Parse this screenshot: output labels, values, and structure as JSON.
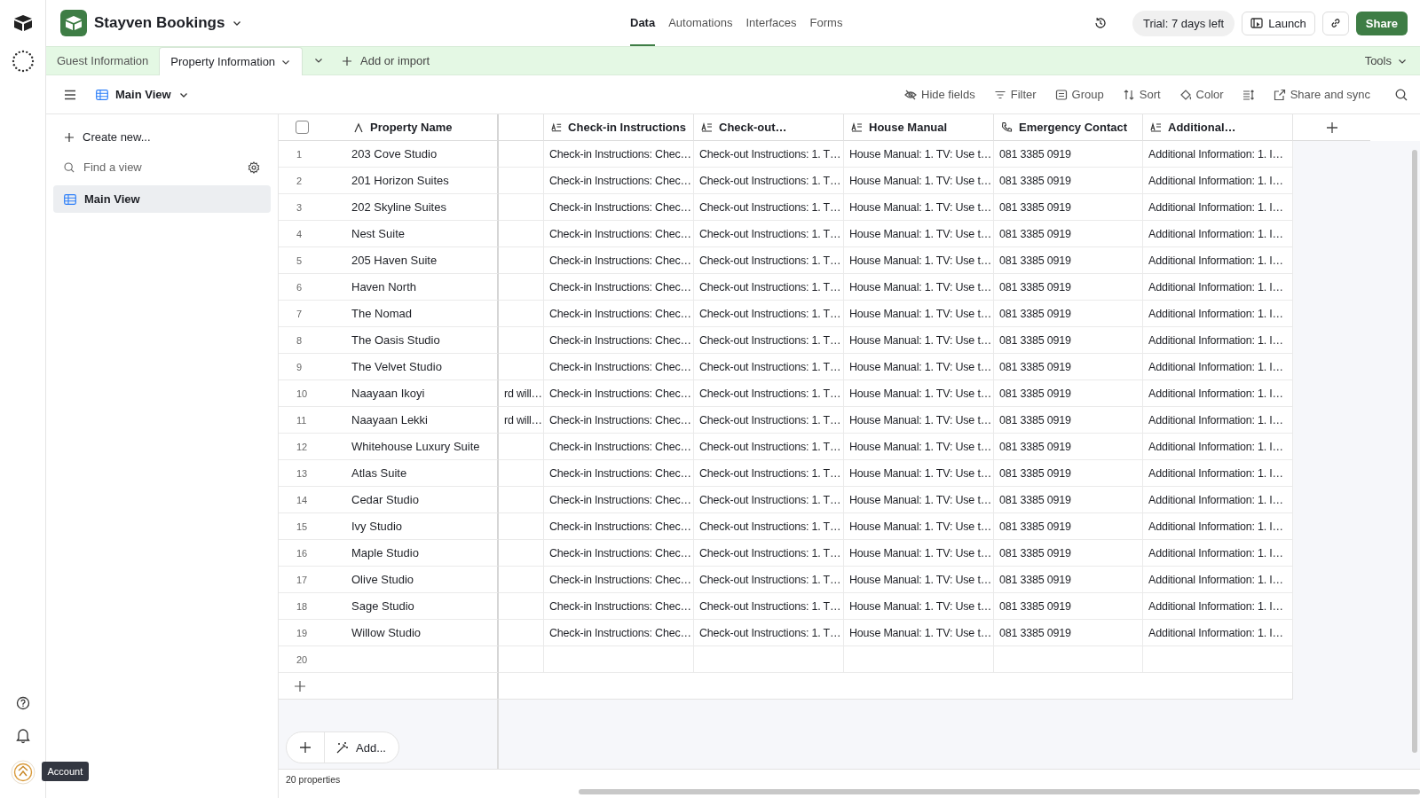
{
  "app": {
    "name": "Stayven Bookings"
  },
  "nav": [
    {
      "label": "Data",
      "selected": true
    },
    {
      "label": "Automations",
      "selected": false
    },
    {
      "label": "Interfaces",
      "selected": false
    },
    {
      "label": "Forms",
      "selected": false
    }
  ],
  "trial_badge": "Trial: 7 days left",
  "header_buttons": {
    "launch": "Launch",
    "share": "Share"
  },
  "table_tabs": [
    {
      "label": "Guest Information",
      "selected": false
    },
    {
      "label": "Property Information",
      "selected": true
    }
  ],
  "add_import": "Add or import",
  "tools": "Tools",
  "view_name": "Main View",
  "view_tools": [
    {
      "label": "Hide fields",
      "kind": "hide"
    },
    {
      "label": "Filter",
      "kind": "filter"
    },
    {
      "label": "Group",
      "kind": "group"
    },
    {
      "label": "Sort",
      "kind": "sort"
    },
    {
      "label": "Color",
      "kind": "color"
    },
    {
      "kind": "row_height"
    },
    {
      "label": "Share and sync",
      "kind": "share"
    }
  ],
  "sidebar": {
    "create": "Create new...",
    "search_placeholder": "Find a view",
    "items": [
      {
        "label": "Main View",
        "selected": true
      }
    ]
  },
  "select_all": {
    "checked": false
  },
  "columns": [
    {
      "label": "Property Name",
      "kind": "primary"
    },
    {
      "kind": "partial"
    },
    {
      "label": "Check-in Instructions",
      "kind": "long_text"
    },
    {
      "label": "Check-out…",
      "kind": "long_text"
    },
    {
      "label": "House Manual",
      "kind": "long_text"
    },
    {
      "label": "Emergency Contact",
      "kind": "phone"
    },
    {
      "label": "Additional…",
      "kind": "long_text"
    }
  ],
  "rows": [
    {
      "number": "1",
      "cells": [
        "203 Cove Studio",
        "",
        "Check-in Instructions: Chec…",
        "Check-out Instructions: 1. T…",
        "House Manual: 1. TV: Use t…",
        "081 3385 0919",
        "Additional Information: 1. I…"
      ]
    },
    {
      "number": "2",
      "cells": [
        "201 Horizon Suites",
        "",
        "Check-in Instructions: Chec…",
        "Check-out Instructions: 1. T…",
        "House Manual: 1. TV: Use t…",
        "081 3385 0919",
        "Additional Information: 1. I…"
      ]
    },
    {
      "number": "3",
      "cells": [
        "202 Skyline Suites",
        "",
        "Check-in Instructions: Chec…",
        "Check-out Instructions: 1. T…",
        "House Manual: 1. TV: Use t…",
        "081 3385 0919",
        "Additional Information: 1. I…"
      ]
    },
    {
      "number": "4",
      "cells": [
        "Nest Suite",
        "",
        "Check-in Instructions: Chec…",
        "Check-out Instructions: 1. T…",
        "House Manual: 1. TV: Use t…",
        "081 3385 0919",
        "Additional Information: 1. I…"
      ]
    },
    {
      "number": "5",
      "cells": [
        "205 Haven Suite",
        "",
        "Check-in Instructions: Chec…",
        "Check-out Instructions: 1. T…",
        "House Manual: 1. TV: Use t…",
        "081 3385 0919",
        "Additional Information: 1. I…"
      ]
    },
    {
      "number": "6",
      "cells": [
        "Haven North",
        "",
        "Check-in Instructions: Chec…",
        "Check-out Instructions: 1. T…",
        "House Manual: 1. TV: Use t…",
        "081 3385 0919",
        "Additional Information: 1. I…"
      ]
    },
    {
      "number": "7",
      "cells": [
        "The Nomad",
        "",
        "Check-in Instructions: Chec…",
        "Check-out Instructions: 1. T…",
        "House Manual: 1. TV: Use t…",
        "081 3385 0919",
        "Additional Information: 1. I…"
      ]
    },
    {
      "number": "8",
      "cells": [
        "The Oasis Studio",
        "",
        "Check-in Instructions: Chec…",
        "Check-out Instructions: 1. T…",
        "House Manual: 1. TV: Use t…",
        "081 3385 0919",
        "Additional Information: 1. I…"
      ]
    },
    {
      "number": "9",
      "cells": [
        "The Velvet Studio",
        "",
        "Check-in Instructions: Chec…",
        "Check-out Instructions: 1. T…",
        "House Manual: 1. TV: Use t…",
        "081 3385 0919",
        "Additional Information: 1. I…"
      ]
    },
    {
      "number": "10",
      "cells": [
        "Naayaan Ikoyi",
        "rd will…",
        "Check-in Instructions: Chec…",
        "Check-out Instructions: 1. T…",
        "House Manual: 1. TV: Use t…",
        "081 3385 0919",
        "Additional Information: 1. I…"
      ]
    },
    {
      "number": "11",
      "cells": [
        "Naayaan Lekki",
        "rd will…",
        "Check-in Instructions: Chec…",
        "Check-out Instructions: 1. T…",
        "House Manual: 1. TV: Use t…",
        "081 3385 0919",
        "Additional Information: 1. I…"
      ]
    },
    {
      "number": "12",
      "cells": [
        "Whitehouse Luxury Suite",
        "",
        "Check-in Instructions: Chec…",
        "Check-out Instructions: 1. T…",
        "House Manual: 1. TV: Use t…",
        "081 3385 0919",
        "Additional Information: 1. I…"
      ]
    },
    {
      "number": "13",
      "cells": [
        "Atlas Suite",
        "",
        "Check-in Instructions: Chec…",
        "Check-out Instructions: 1. T…",
        "House Manual: 1. TV: Use t…",
        "081 3385 0919",
        "Additional Information: 1. I…"
      ]
    },
    {
      "number": "14",
      "cells": [
        "Cedar Studio",
        "",
        "Check-in Instructions: Chec…",
        "Check-out Instructions: 1. T…",
        "House Manual: 1. TV: Use t…",
        "081 3385 0919",
        "Additional Information: 1. I…"
      ]
    },
    {
      "number": "15",
      "cells": [
        "Ivy Studio",
        "",
        "Check-in Instructions: Chec…",
        "Check-out Instructions: 1. T…",
        "House Manual: 1. TV: Use t…",
        "081 3385 0919",
        "Additional Information: 1. I…"
      ]
    },
    {
      "number": "16",
      "cells": [
        "Maple Studio",
        "",
        "Check-in Instructions: Chec…",
        "Check-out Instructions: 1. T…",
        "House Manual: 1. TV: Use t…",
        "081 3385 0919",
        "Additional Information: 1. I…"
      ]
    },
    {
      "number": "17",
      "cells": [
        "Olive Studio",
        "",
        "Check-in Instructions: Chec…",
        "Check-out Instructions: 1. T…",
        "House Manual: 1. TV: Use t…",
        "081 3385 0919",
        "Additional Information: 1. I…"
      ]
    },
    {
      "number": "18",
      "cells": [
        "Sage Studio",
        "",
        "Check-in Instructions: Chec…",
        "Check-out Instructions: 1. T…",
        "House Manual: 1. TV: Use t…",
        "081 3385 0919",
        "Additional Information: 1. I…"
      ]
    },
    {
      "number": "19",
      "cells": [
        "Willow Studio",
        "",
        "Check-in Instructions: Chec…",
        "Check-out Instructions: 1. T…",
        "House Manual: 1. TV: Use t…",
        "081 3385 0919",
        "Additional Information: 1. I…"
      ]
    },
    {
      "number": "20",
      "cells": []
    }
  ],
  "add_button": "Add...",
  "record_count": "20 properties",
  "tooltip": "Account"
}
